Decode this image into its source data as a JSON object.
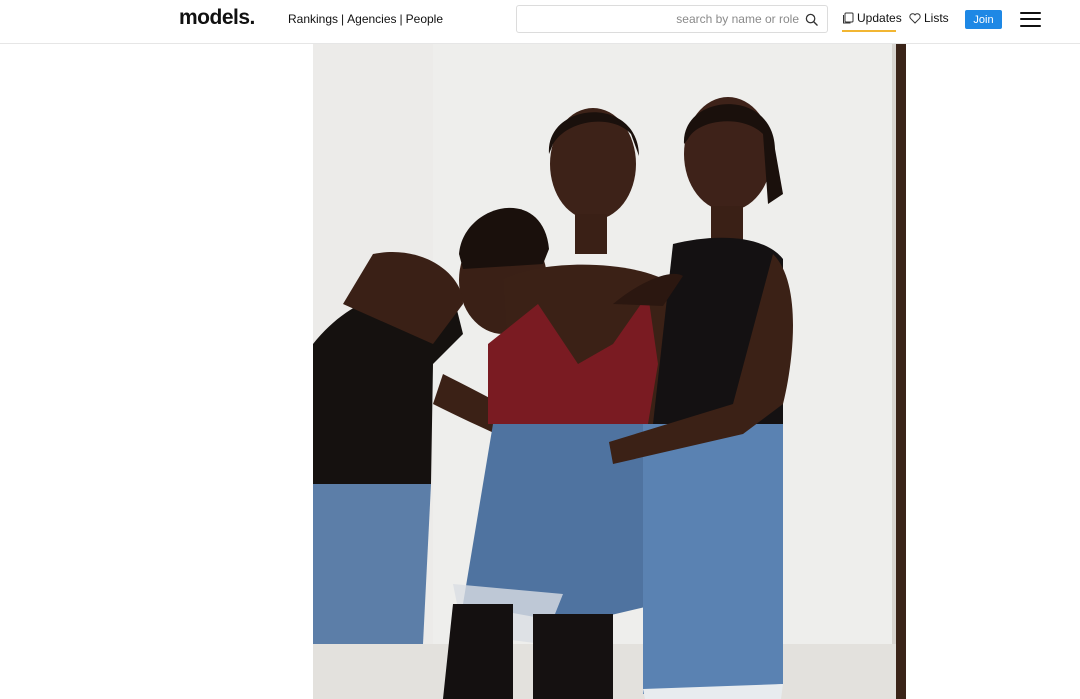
{
  "brand": {
    "logo_text": "models."
  },
  "nav": {
    "items": [
      "Rankings",
      "Agencies",
      "People"
    ],
    "separator": "|"
  },
  "search": {
    "placeholder": "search by name or role",
    "icon": "search-icon"
  },
  "actions": {
    "updates_label": "Updates",
    "updates_icon": "copy-stack-icon",
    "lists_label": "Lists",
    "lists_icon": "heart-outline-icon",
    "join_label": "Join",
    "menu_icon": "hamburger-menu-icon"
  },
  "colors": {
    "accent": "#1e88e5",
    "updates_underline": "#f2b632",
    "text": "#111111"
  },
  "photo": {
    "subject": "three models posing against a white wall"
  }
}
